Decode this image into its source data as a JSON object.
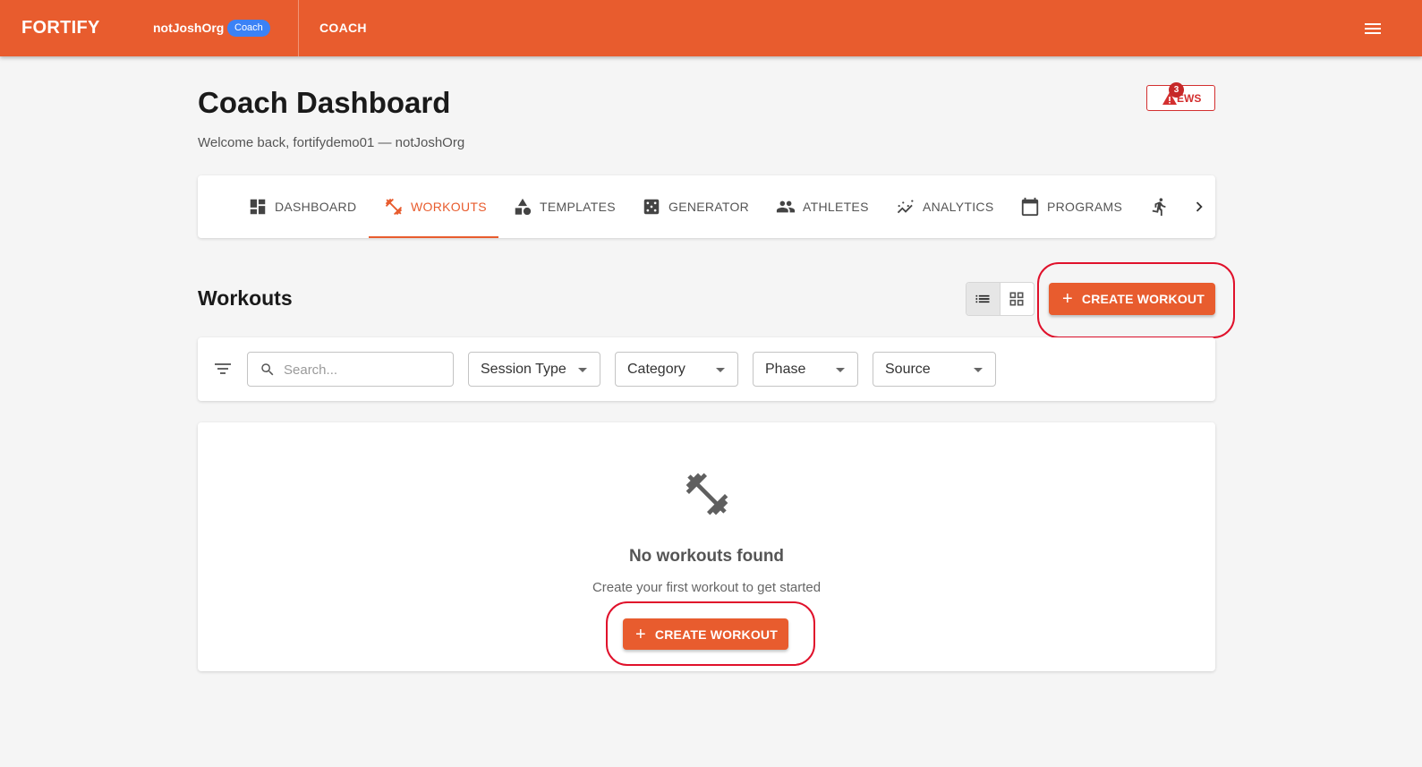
{
  "app": {
    "brand": "FORTIFY",
    "org_name": "notJoshOrg",
    "role_badge": "Coach",
    "nav_link": "COACH",
    "accent_color": "#e85c2e"
  },
  "header": {
    "title": "Coach Dashboard",
    "welcome": "Welcome back, fortifydemo01 — notJoshOrg",
    "ews_label": "EWS",
    "ews_count": "3"
  },
  "tabs": [
    {
      "label": "DASHBOARD",
      "icon": "dashboard-icon"
    },
    {
      "label": "WORKOUTS",
      "icon": "dumbbell-icon",
      "active": true
    },
    {
      "label": "TEMPLATES",
      "icon": "shapes-icon"
    },
    {
      "label": "GENERATOR",
      "icon": "dice-icon"
    },
    {
      "label": "ATHLETES",
      "icon": "people-icon"
    },
    {
      "label": "ANALYTICS",
      "icon": "trend-icon"
    },
    {
      "label": "PROGRAMS",
      "icon": "calendar-icon"
    },
    {
      "label": "",
      "icon": "running-icon"
    }
  ],
  "workouts": {
    "title": "Workouts",
    "create_label": "CREATE WORKOUT",
    "view_modes": [
      "list",
      "grid"
    ],
    "selected_view": "list"
  },
  "filters": {
    "search_placeholder": "Search...",
    "session_type": "Session Type",
    "category": "Category",
    "phase": "Phase",
    "source": "Source"
  },
  "empty_state": {
    "title": "No workouts found",
    "subtitle": "Create your first workout to get started",
    "button_label": "CREATE WORKOUT"
  }
}
